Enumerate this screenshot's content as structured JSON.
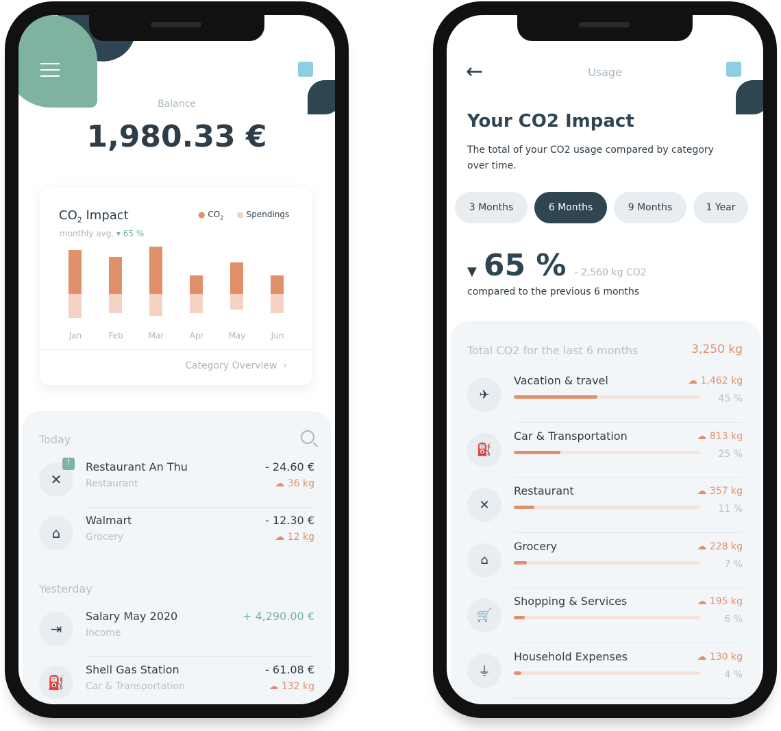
{
  "left": {
    "balance_label": "Balance",
    "balance": "1,980.33 €",
    "card": {
      "title": "CO",
      "title_sub": "2",
      "title_rest": " Impact",
      "legend_co2": "CO",
      "legend_co2_sub": "2",
      "legend_spend": "Spendings",
      "avg_label": "monthly avg.",
      "avg_value": "65 %",
      "link": "Category Overview"
    },
    "sections": [
      {
        "label": "Today",
        "items": [
          {
            "title": "Restaurant An Thu",
            "sub": "Restaurant",
            "amount": "- 24.60 €",
            "kg": "36 kg",
            "icon": "cutlery-icon",
            "badge": "!"
          },
          {
            "title": "Walmart",
            "sub": "Grocery",
            "amount": "- 12.30 €",
            "kg": "12 kg",
            "icon": "basket-icon"
          }
        ]
      },
      {
        "label": "Yesterday",
        "items": [
          {
            "title": "Salary May 2020",
            "sub": "Income",
            "amount": "+ 4,290.00 €",
            "icon": "income-icon"
          },
          {
            "title": "Shell Gas Station",
            "sub": "Car & Transportation",
            "amount": "- 61.08 €",
            "kg": "132 kg",
            "icon": "fuel-icon"
          }
        ]
      }
    ]
  },
  "chart_data": {
    "type": "bar",
    "stacked": "diverging",
    "categories": [
      "Jan",
      "Feb",
      "Mar",
      "Apr",
      "May",
      "Jun"
    ],
    "series": [
      {
        "name": "CO2",
        "values": [
          64,
          54,
          69,
          27,
          46,
          27
        ],
        "color": "#e0906a"
      },
      {
        "name": "Spendings",
        "values": [
          35,
          28,
          32,
          28,
          23,
          28
        ],
        "color": "#f5d2c3"
      }
    ],
    "grid": false,
    "legend": "top-right"
  },
  "right": {
    "header_title": "Usage",
    "title": "Your CO2 Impact",
    "description": "The total of your CO2 usage compared by category over time.",
    "periods": [
      {
        "label": "3 Months",
        "active": false
      },
      {
        "label": "6 Months",
        "active": true
      },
      {
        "label": "9 Months",
        "active": false
      },
      {
        "label": "1 Year",
        "active": false
      }
    ],
    "change": "65 %",
    "change_kg": "- 2,560 kg CO2",
    "change_caption": "compared to the previous 6 months",
    "total_label": "Total CO2 for the last 6 months",
    "total_value": "3,250 kg",
    "categories": [
      {
        "name": "Vacation & travel",
        "kg": "1,462 kg",
        "percent": "45 %",
        "value": 45,
        "icon": "airplane-icon"
      },
      {
        "name": "Car & Transportation",
        "kg": "813 kg",
        "percent": "25 %",
        "value": 25,
        "icon": "fuel-icon"
      },
      {
        "name": "Restaurant",
        "kg": "357 kg",
        "percent": "11 %",
        "value": 11,
        "icon": "cutlery-icon"
      },
      {
        "name": "Grocery",
        "kg": "228 kg",
        "percent": "7 %",
        "value": 7,
        "icon": "basket-icon"
      },
      {
        "name": "Shopping & Services",
        "kg": "195 kg",
        "percent": "6 %",
        "value": 6,
        "icon": "cart-icon"
      },
      {
        "name": "Household Expenses",
        "kg": "130 kg",
        "percent": "4 %",
        "value": 4,
        "icon": "plug-icon"
      }
    ]
  },
  "colors": {
    "accent": "#e0906a",
    "dark": "#2e4552",
    "green": "#7fb3a0",
    "light_blue": "#8ccfe0"
  }
}
